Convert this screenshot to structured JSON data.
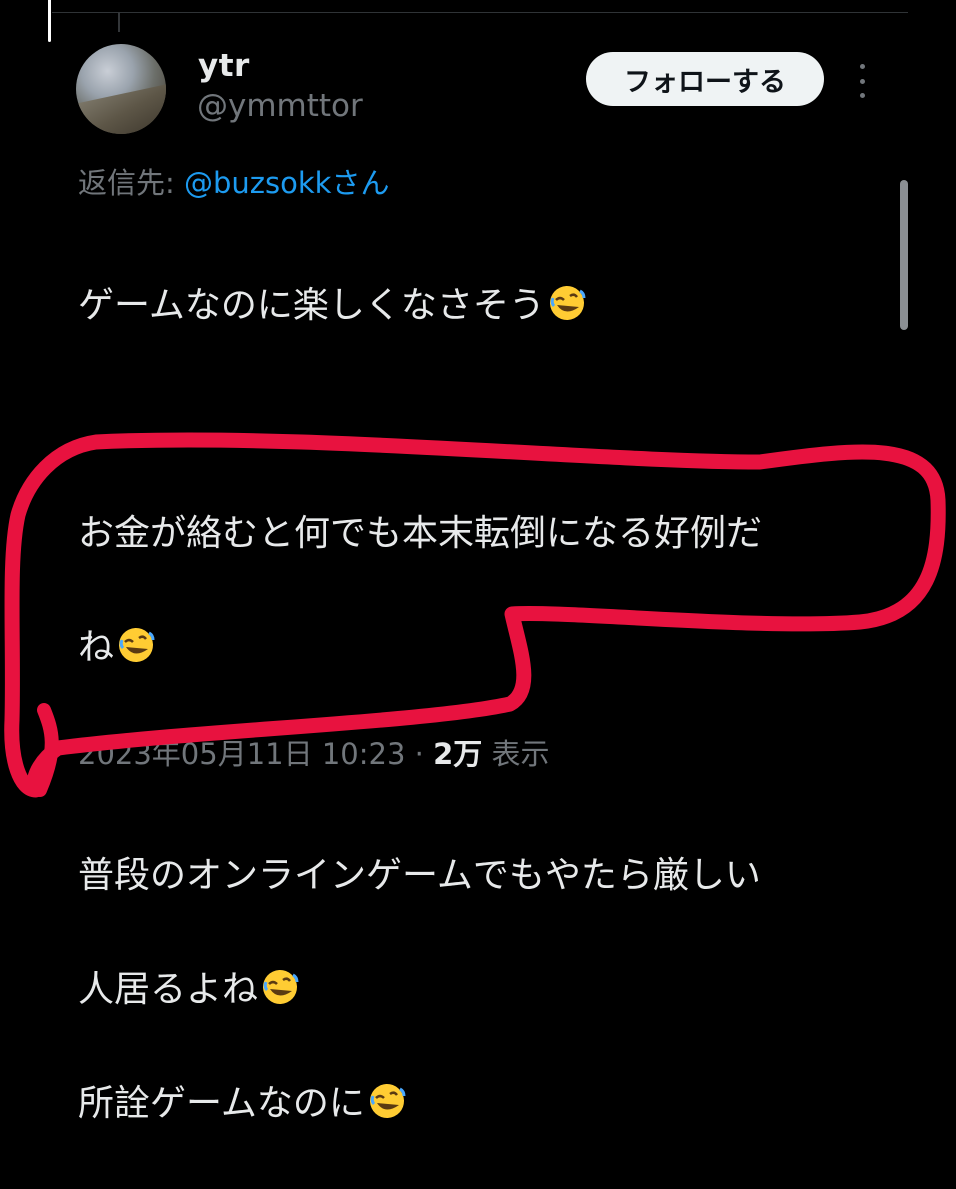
{
  "author": {
    "display_name": "ytr",
    "handle": "@ymmttor"
  },
  "follow_button": {
    "label": "フォローする"
  },
  "reply": {
    "prefix": "返信先: ",
    "mention": "@buzsokkさん"
  },
  "tweet": {
    "lines": [
      "ゲームなのに楽しくなさそう",
      "",
      "お金が絡むと何でも本末転倒になる好例だ",
      "ね",
      "",
      "普段のオンラインゲームでもやたら厳しい",
      "人居るよね",
      "所詮ゲームなのに"
    ],
    "emoji_name": "rolling-on-the-floor-laughing-icon"
  },
  "meta": {
    "timestamp": "2023年05月11日 10:23",
    "separator": " · ",
    "views_count": "2万",
    "views_label": " 表示"
  },
  "colors": {
    "background": "#000000",
    "text_primary": "#e7e9ea",
    "text_secondary": "#71767b",
    "link": "#1d9bf0",
    "annotation": "#e8123f"
  }
}
